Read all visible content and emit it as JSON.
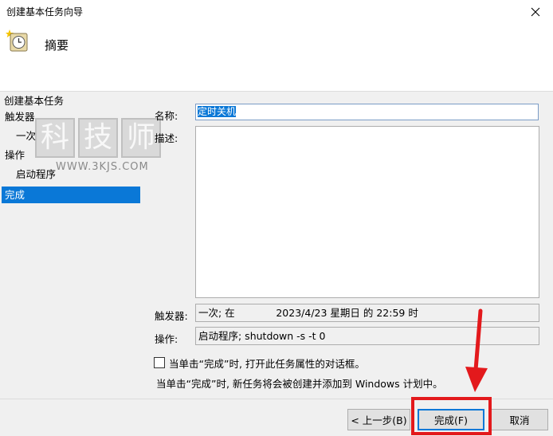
{
  "window": {
    "title": "创建基本任务向导"
  },
  "header": {
    "title": "摘要"
  },
  "sidebar": {
    "title": "创建基本任务",
    "items": [
      {
        "label": "触发器"
      },
      {
        "label": "一次"
      },
      {
        "label": "操作"
      },
      {
        "label": "启动程序"
      },
      {
        "label": "完成"
      }
    ]
  },
  "form": {
    "name_label": "名称:",
    "name_value": "定时关机",
    "description_label": "描述:",
    "trigger_label": "触发器:",
    "trigger_value": "一次; 在             2023/4/23 星期日 的 22:59 时",
    "action_label": "操作:",
    "action_value": "启动程序; shutdown -s -t 0"
  },
  "checkbox": {
    "label": "当单击“完成”时, 打开此任务属性的对话框。",
    "checked": false
  },
  "info_text": "当单击“完成”时, 新任务将会被创建并添加到 Windows 计划中。",
  "buttons": {
    "back": "< 上一步(B)",
    "finish": "完成(F)",
    "cancel": "取消"
  },
  "watermark": {
    "chars": [
      "科",
      "技",
      "师"
    ],
    "url": "WWW.3KJS.COM"
  },
  "colors": {
    "accent": "#0a78d7",
    "highlight_red": "#e3191c"
  }
}
